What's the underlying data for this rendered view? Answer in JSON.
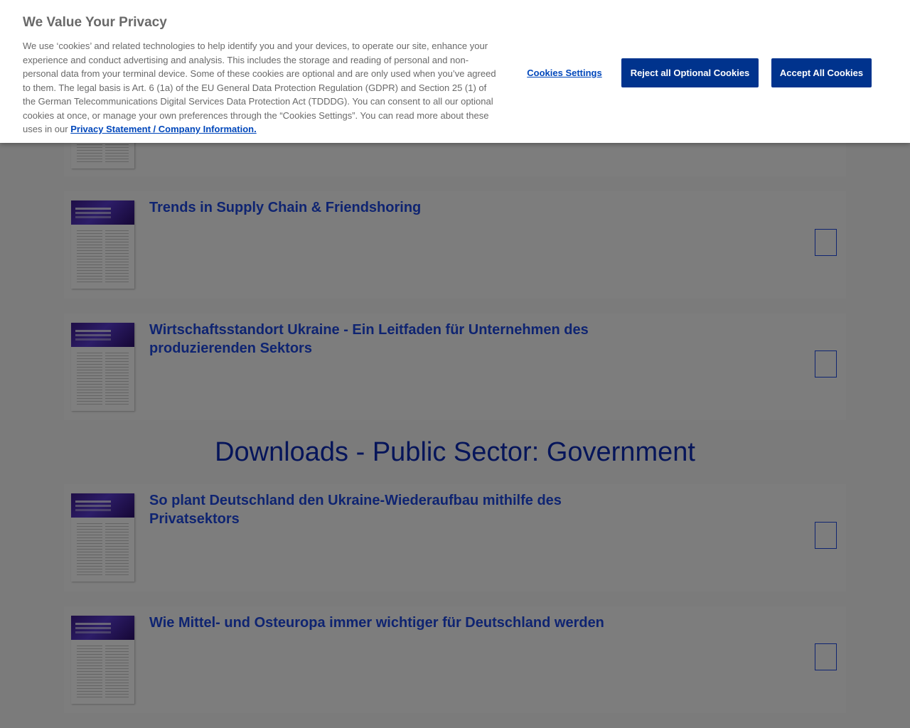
{
  "cookie_banner": {
    "title": "We Value Your Privacy",
    "body": "We use ‘cookies’ and related technologies to help identify you and your devices, to operate our site, enhance your experience and conduct advertising and analysis. This includes the storage and reading of personal and non-personal data from your terminal device. Some of these cookies are optional and are only used when you’ve agreed to them. The legal basis is Art. 6 (1a) of the EU General Data Protection Regulation (GDPR) and Section 25 (1) of the German Telecommunications Digital Services Data Protection Act (TDDDG). You can consent to all our optional cookies at once, or manage your own preferences through the “Cookies Settings”. You can read more about these uses in our",
    "privacy_link": "Privacy Statement / Company Information.",
    "settings_label": "Cookies Settings",
    "reject_label": "Reject all Optional Cookies",
    "accept_label": "Accept All Cookies"
  },
  "downloads": [
    {
      "title": "Trends in Supply Chain & Friendshoring"
    },
    {
      "title": "Wirtschaftsstandort Ukraine - Ein Leitfaden für Unternehmen des produzierenden Sektors"
    }
  ],
  "section": {
    "title": "Downloads - Public Sector: Government"
  },
  "gov_downloads": [
    {
      "title": "So plant Deutschland den Ukraine-Wiederaufbau mithilfe des Privatsektors"
    },
    {
      "title": "Wie Mittel- und Osteuropa immer wichtiger für Deutschland werden"
    }
  ],
  "colors": {
    "accent": "#1e49e2",
    "brand": "#00338d",
    "link": "#0047bb"
  },
  "icons": {
    "download": "download-icon"
  }
}
